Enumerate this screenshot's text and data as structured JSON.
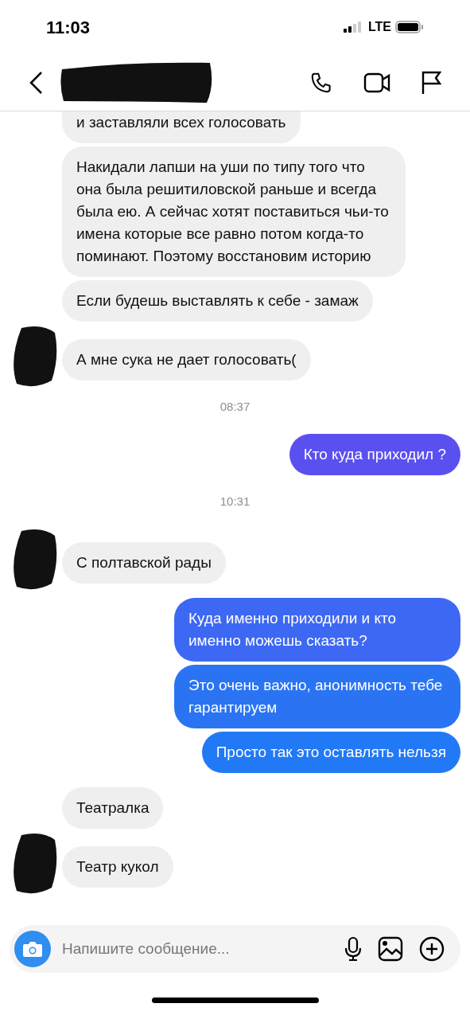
{
  "status_bar": {
    "time": "11:03",
    "network": "LTE"
  },
  "header": {
    "name_redacted": true
  },
  "messages": [
    {
      "kind": "received",
      "text": "и заставляли всех голосовать",
      "cut_top": true,
      "avatar_redacted": false
    },
    {
      "kind": "received",
      "text": "Накидали лапши на уши по типу того что она была решитиловской раньше и всегда была ею. А сейчас хотят поставиться чьи-то имена которые все равно потом когда-то поминают. Поэтому восстановим историю",
      "cut_top": false,
      "avatar_redacted": false
    },
    {
      "kind": "received",
      "text": "Если будешь выставлять к себе - замаж",
      "cut_top": false,
      "avatar_redacted": false
    },
    {
      "kind": "received",
      "text": "А мне сука не дает голосовать(",
      "cut_top": false,
      "avatar_redacted": true
    },
    {
      "kind": "timestamp",
      "text": "08:37"
    },
    {
      "kind": "sent",
      "text": "Кто куда приходил ?",
      "color": "#5a50f0"
    },
    {
      "kind": "timestamp",
      "text": "10:31"
    },
    {
      "kind": "received",
      "text": "С полтавской рады",
      "cut_top": false,
      "avatar_redacted": true
    },
    {
      "kind": "sent",
      "text": "Куда именно приходили и кто именно можешь сказать?",
      "color": "#3d68f4"
    },
    {
      "kind": "sent",
      "text": "Это очень важно, анонимность тебе гарантируем",
      "color": "#2a74f4"
    },
    {
      "kind": "sent",
      "text": "Просто так это оставлять нельзя",
      "color": "#2279f5"
    },
    {
      "kind": "received",
      "text": "Театралка",
      "cut_top": false,
      "avatar_redacted": false
    },
    {
      "kind": "received",
      "text": "Театр кукол",
      "cut_top": false,
      "avatar_redacted": true
    }
  ],
  "composer": {
    "placeholder": "Напишите сообщение..."
  }
}
